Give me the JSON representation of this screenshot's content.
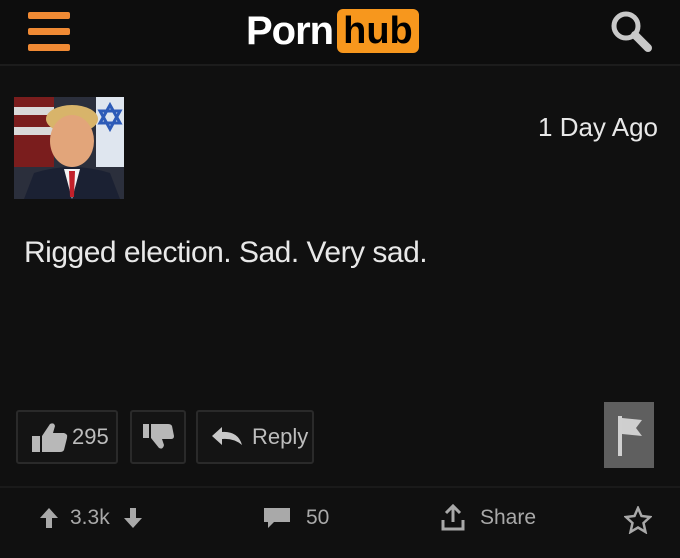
{
  "header": {
    "logo_left": "Porn",
    "logo_right": "hub",
    "menu_icon": "hamburger-menu-icon",
    "search_icon": "search-icon",
    "accent_color": "#f7971d"
  },
  "comment": {
    "timestamp": "1 Day Ago",
    "text": "Rigged election. Sad. Very sad.",
    "likes": "295",
    "reply_label": "Reply"
  },
  "footer": {
    "votes": "3.3k",
    "comments": "50",
    "share_label": "Share"
  }
}
